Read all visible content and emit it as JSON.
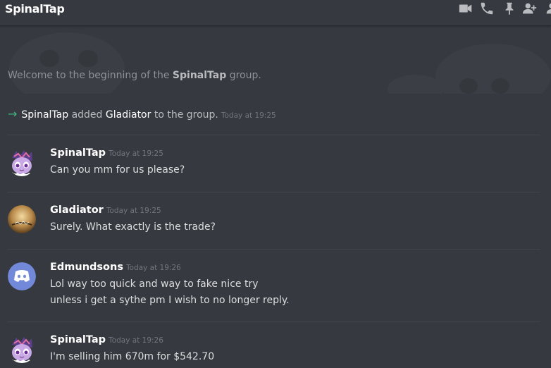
{
  "header": {
    "title": "SpinalTap",
    "icons": [
      "video-icon",
      "phone-icon",
      "pin-icon",
      "add-member-icon",
      "members-icon"
    ]
  },
  "welcome": {
    "prefix": "Welcome to the beginning of the ",
    "group": "SpinalTap",
    "suffix": " group."
  },
  "system_message": {
    "actor": "SpinalTap",
    "action": " added ",
    "target": "Gladiator",
    "suffix": " to the group.",
    "timestamp": "Today at 19:25"
  },
  "messages": [
    {
      "author": "SpinalTap",
      "timestamp": "Today at 19:25",
      "lines": [
        "Can you mm for us please?"
      ]
    },
    {
      "author": "Gladiator",
      "timestamp": "Today at 19:25",
      "lines": [
        "Surely. What exactly is the trade?"
      ]
    },
    {
      "author": "Edmundsons",
      "timestamp": "Today at 19:26",
      "lines": [
        "Lol way too quick and way to fake nice try",
        "unless i get a sythe pm I wish to no longer reply."
      ]
    },
    {
      "author": "SpinalTap",
      "timestamp": "Today at 19:26",
      "lines": [
        "I'm selling him 670m for $542.70"
      ]
    }
  ],
  "colors": {
    "background": "#36393f",
    "accent_green": "#43b581",
    "blurple": "#7289da"
  }
}
